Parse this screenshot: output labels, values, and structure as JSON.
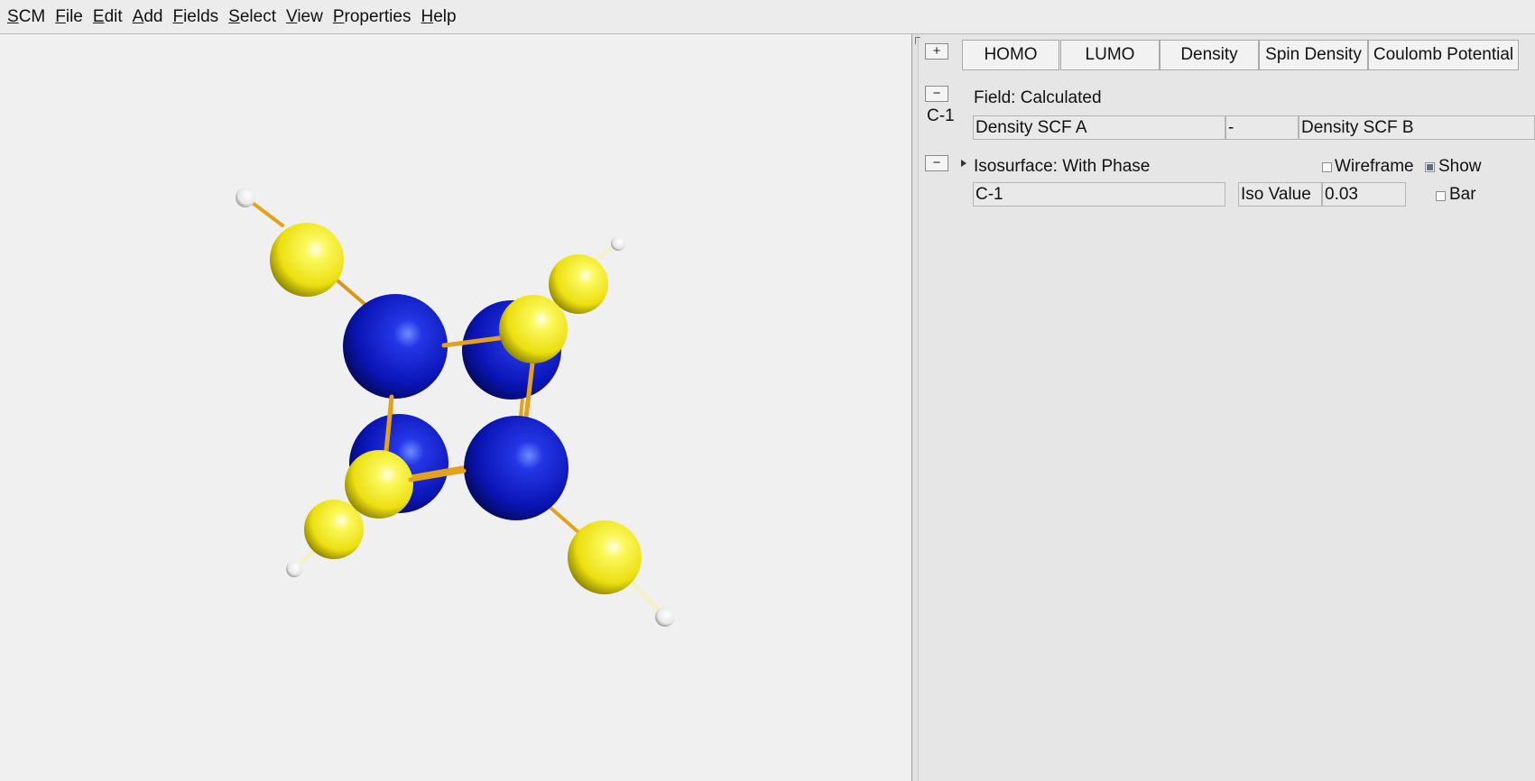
{
  "menu": [
    "SCM",
    "File",
    "Edit",
    "Add",
    "Fields",
    "Select",
    "View",
    "Properties",
    "Help"
  ],
  "panel": {
    "expand_btn": "+",
    "collapse_btn": "−",
    "tabs": [
      "HOMO",
      "LUMO",
      "Density",
      "Spin Density",
      "Coulomb Potential"
    ],
    "field_row": {
      "molecule_label": "C-1",
      "title": "Field: Calculated",
      "operand_a": "Density SCF A",
      "operator": "-",
      "operand_b": "Density SCF B"
    },
    "isosurface": {
      "title": "Isosurface: With Phase",
      "wireframe_label": "Wireframe",
      "wireframe_checked": false,
      "show_label": "Show",
      "show_checked": true,
      "object_value": "C-1",
      "iso_label": "Iso Value",
      "iso_value": "0.03",
      "bar_label": "Bar",
      "bar_checked": false
    }
  },
  "colors": {
    "carbon": "#0a14b4",
    "isosurface": "#f2ee20",
    "bond": "#e3a21a",
    "hydrogen": "#ffffff"
  }
}
